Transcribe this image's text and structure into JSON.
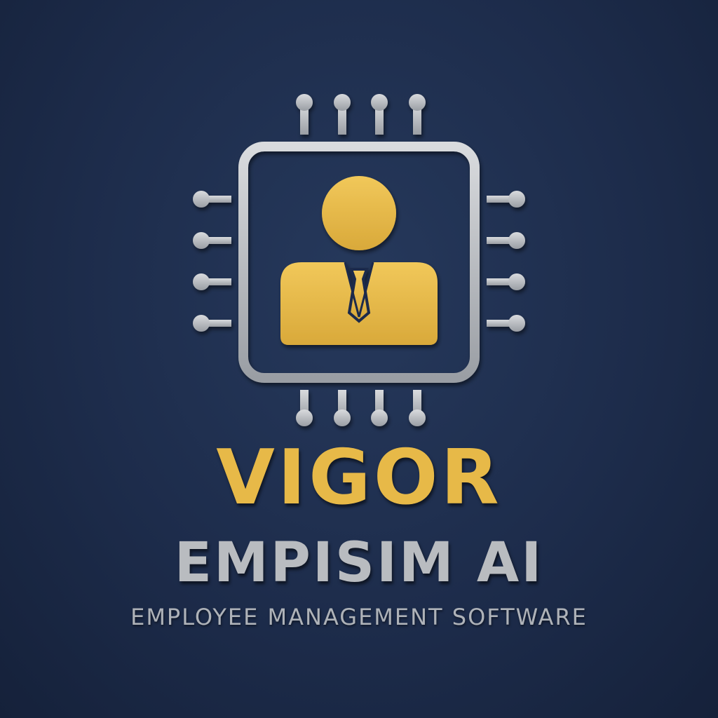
{
  "logo": {
    "icon": "chip-person-icon",
    "brand_name": "VIGOR",
    "product_name": "EMPISIM AI",
    "tagline": "EMPLOYEE MANAGEMENT SOFTWARE"
  },
  "colors": {
    "background": "#1d2c4b",
    "gold": "#e7b948",
    "silver": "#b9bcc0"
  }
}
